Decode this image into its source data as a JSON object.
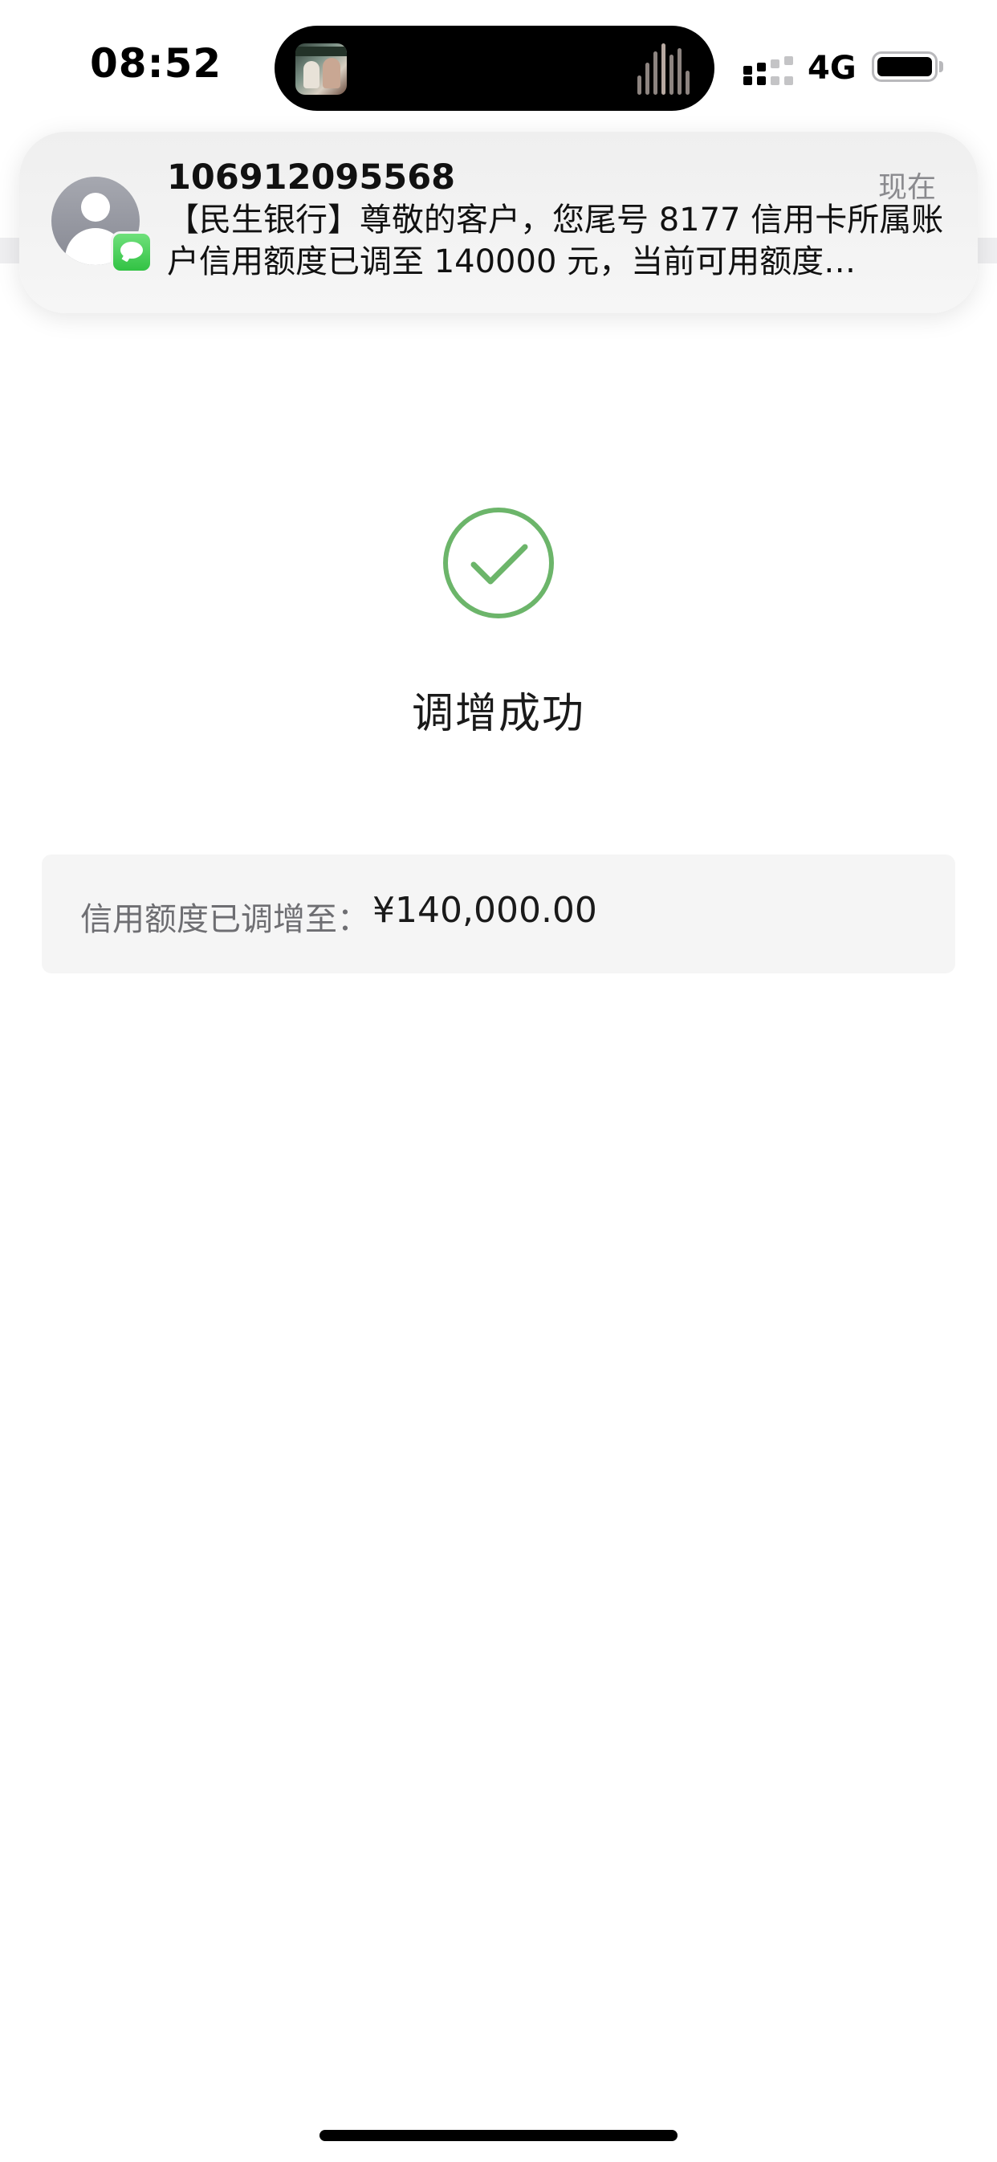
{
  "status_bar": {
    "time": "08:52",
    "network": "4G",
    "icons": [
      "cellular-signal-icon",
      "battery-icon"
    ]
  },
  "dynamic_island": {
    "activity": "now-playing",
    "icons": [
      "album-art-icon",
      "audio-waveform-icon"
    ]
  },
  "notification": {
    "app_icon": "messages-app-icon",
    "sender": "106912095568",
    "time": "现在",
    "body": "【民生银行】尊敬的客户，您尾号 8177 信用卡所属账户信用额度已调至 140000 元，当前可用额度…"
  },
  "result": {
    "icon": "success-check-icon",
    "icon_color": "#6cb56a",
    "title": "调增成功"
  },
  "credit_info": {
    "label": "信用额度已调增至：",
    "value": "¥140,000.00"
  }
}
